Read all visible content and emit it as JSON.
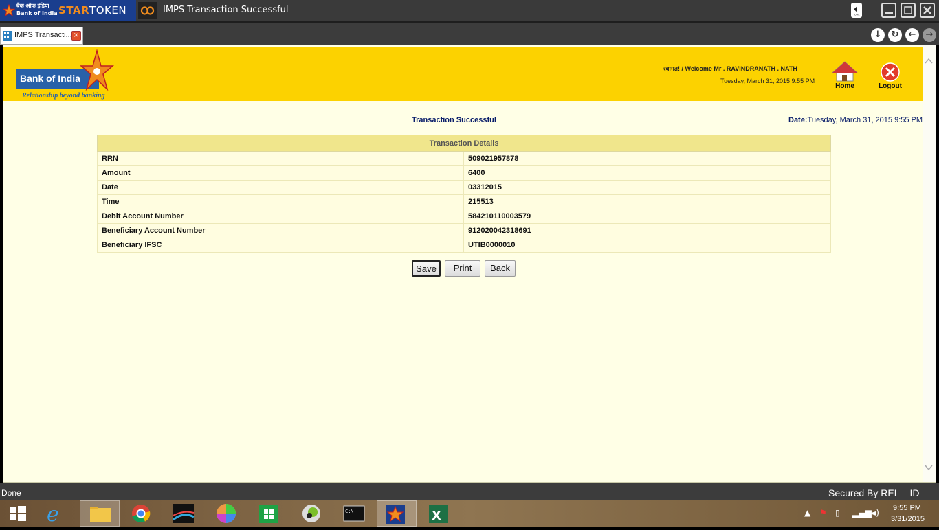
{
  "window": {
    "app_name_hindi": "बैंक ऑफ इंडिया",
    "app_name": "Bank of India",
    "brand_star": "STAR",
    "brand_token": "TOKEN",
    "title": "IMPS Transaction Successful",
    "url_badge": "URL"
  },
  "tab": {
    "label": "IMPS Transacti...",
    "close": "×"
  },
  "nav": {
    "download": "↓",
    "refresh": "↻",
    "back": "←",
    "forward": "→"
  },
  "header": {
    "bank_name": "Bank of India",
    "tagline": "Relationship beyond banking",
    "welcome": "स्वागत! / Welcome Mr . RAVINDRANATH . NATH",
    "datetime": "Tuesday, March 31, 2015 9:55 PM",
    "home_label": "Home",
    "logout_label": "Logout"
  },
  "page": {
    "heading": "Transaction Successful",
    "date_label": "Date:",
    "date_value": "Tuesday, March 31, 2015 9:55 PM"
  },
  "details": {
    "title": "Transaction Details",
    "rows": [
      {
        "label": "RRN",
        "value": "509021957878"
      },
      {
        "label": "Amount",
        "value": "6400"
      },
      {
        "label": "Date",
        "value": "03312015"
      },
      {
        "label": "Time",
        "value": "215513"
      },
      {
        "label": "Debit Account Number",
        "value": "584210110003579"
      },
      {
        "label": "Beneficiary Account Number",
        "value": "912020042318691"
      },
      {
        "label": "Beneficiary IFSC",
        "value": "UTIB0000010"
      }
    ]
  },
  "actions": {
    "save": "Save",
    "print": "Print",
    "back": "Back"
  },
  "status": {
    "text": "Done",
    "secured": "Secured By REL – ID"
  },
  "taskbar": {
    "time": "9:55 PM",
    "date": "3/31/2015"
  },
  "colors": {
    "header_bg": "#fcd200",
    "content_bg": "#ffffe6",
    "table_header_bg": "#f0e68c",
    "brand_blue": "#2961a8",
    "brand_orange": "#f08c1e"
  }
}
